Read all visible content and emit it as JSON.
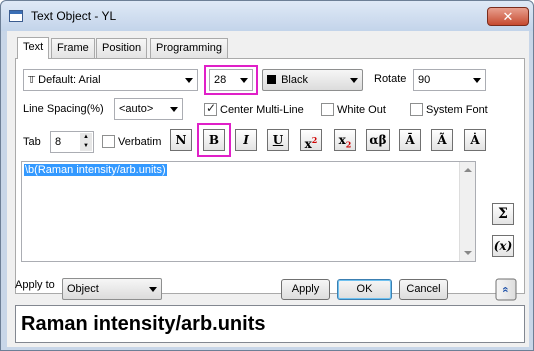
{
  "window": {
    "title": "Text Object - YL",
    "close_label": "✕"
  },
  "tabs": [
    {
      "label": "Text",
      "active": true
    },
    {
      "label": "Frame",
      "active": false
    },
    {
      "label": "Position",
      "active": false
    },
    {
      "label": "Programming",
      "active": false
    }
  ],
  "font": {
    "icon": "𝕋",
    "value": "Default: Arial"
  },
  "size": {
    "value": "28"
  },
  "color": {
    "value": "Black",
    "swatch": "#000000"
  },
  "rotate": {
    "label": "Rotate",
    "value": "90"
  },
  "line_spacing": {
    "label": "Line Spacing(%)",
    "value": "<auto>"
  },
  "checkboxes": {
    "center_multiline": {
      "label": "Center Multi-Line",
      "checked": true
    },
    "white_out": {
      "label": "White Out",
      "checked": false
    },
    "system_font": {
      "label": "System Font",
      "checked": false
    },
    "verbatim": {
      "label": "Verbatim",
      "checked": false
    }
  },
  "tab": {
    "label": "Tab",
    "value": "8"
  },
  "format_buttons": [
    {
      "name": "normal",
      "label": "N"
    },
    {
      "name": "bold",
      "label": "B"
    },
    {
      "name": "italic",
      "label": "I"
    },
    {
      "name": "underline",
      "label": "U"
    },
    {
      "name": "superscript",
      "label": "x",
      "mark": "2"
    },
    {
      "name": "subscript",
      "label": "x",
      "mark": "2"
    },
    {
      "name": "greek",
      "label": "αβ"
    },
    {
      "name": "overbar",
      "label": "Ā"
    },
    {
      "name": "tilde",
      "label": "Ã"
    },
    {
      "name": "dot",
      "label": "Ȧ"
    }
  ],
  "editor": {
    "text": "\\b(Raman intensity/arb.units)"
  },
  "side_buttons": {
    "sigma": "Σ",
    "var": "(x)"
  },
  "apply_to": {
    "label": "Apply to",
    "value": "Object"
  },
  "buttons": {
    "apply": "Apply",
    "ok": "OK",
    "cancel": "Cancel",
    "expand": "»"
  },
  "preview": {
    "text": "Raman intensity/arb.units"
  },
  "colors": {
    "highlight": "#e020c8",
    "selection": "#3399ff"
  }
}
